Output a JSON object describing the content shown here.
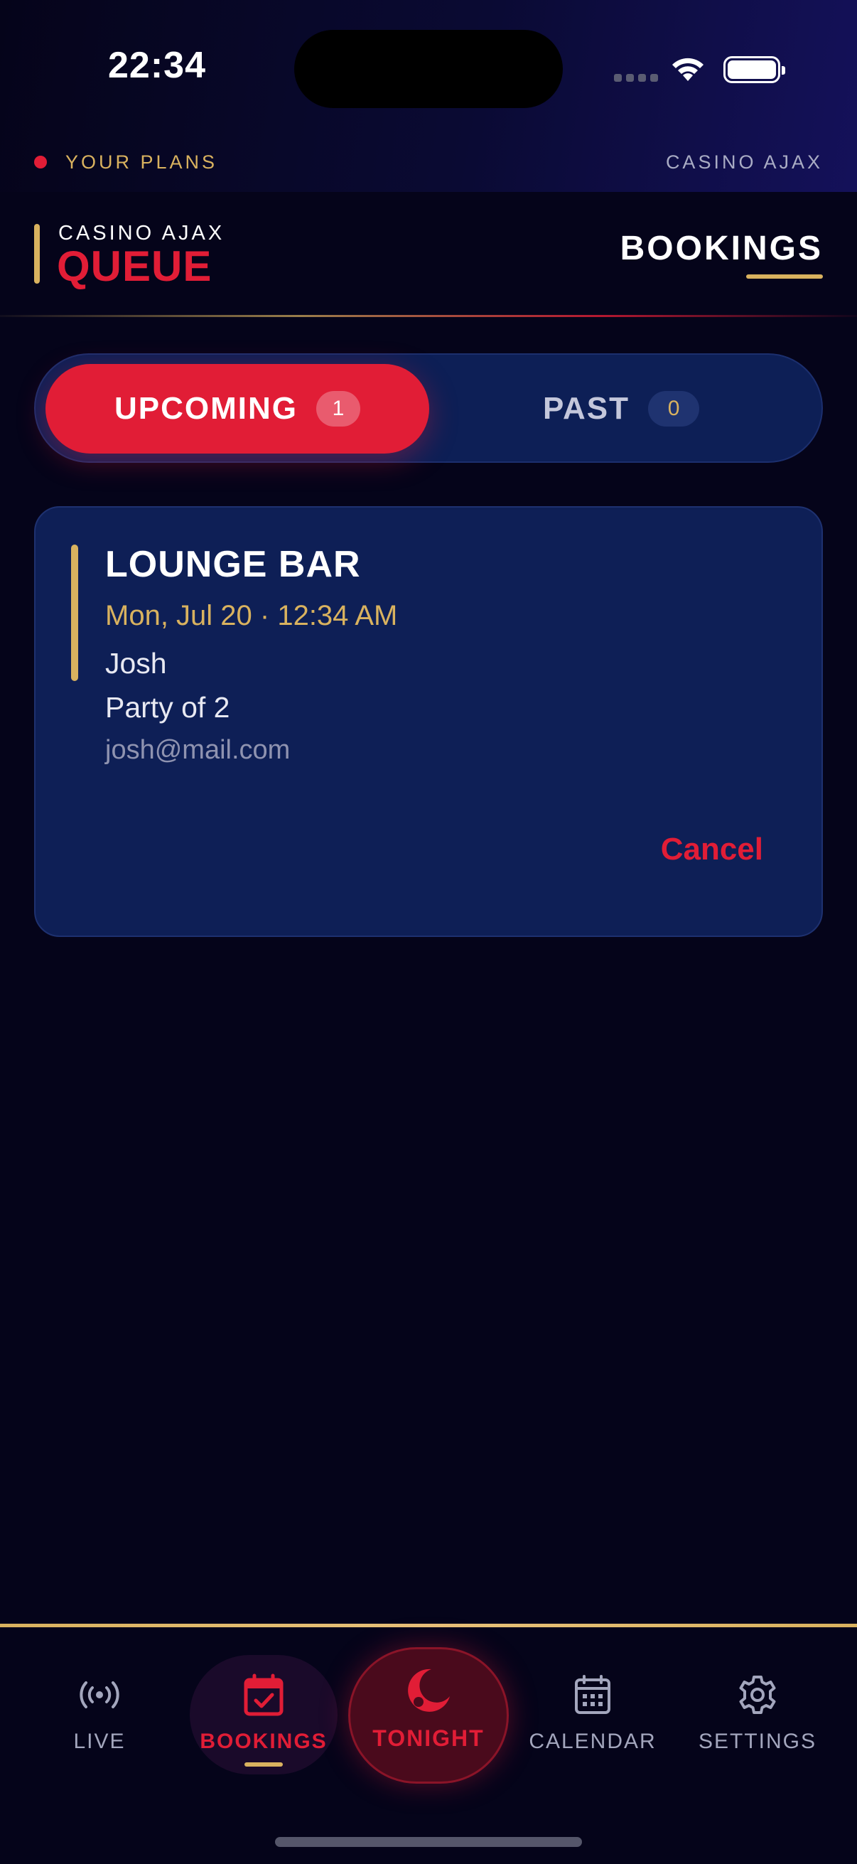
{
  "status_bar": {
    "time": "22:34"
  },
  "top_strip": {
    "left_label": "YOUR PLANS",
    "right_label": "CASINO AJAX"
  },
  "header": {
    "brand_sub": "CASINO AJAX",
    "brand_main": "QUEUE",
    "page_title": "BOOKINGS"
  },
  "segments": {
    "upcoming": {
      "label": "UPCOMING",
      "count": "1",
      "selected": true
    },
    "past": {
      "label": "PAST",
      "count": "0",
      "selected": false
    }
  },
  "bookings": [
    {
      "venue": "LOUNGE BAR",
      "when": "Mon, Jul 20 · 12:34 AM",
      "guest": "Josh",
      "party": "Party of 2",
      "email": "josh@mail.com",
      "cancel_label": "Cancel"
    }
  ],
  "nav": {
    "live": {
      "label": "LIVE",
      "icon": "broadcast-icon"
    },
    "bookings": {
      "label": "BOOKINGS",
      "icon": "calendar-check-icon",
      "active": true
    },
    "tonight": {
      "label": "TONIGHT",
      "icon": "moon-icon"
    },
    "calendar": {
      "label": "CALENDAR",
      "icon": "calendar-icon"
    },
    "settings": {
      "label": "SETTINGS",
      "icon": "gear-icon"
    }
  },
  "colors": {
    "background": "#05041a",
    "accent_red": "#e11d36",
    "accent_gold": "#d9b25f",
    "card": "#0e1f56"
  }
}
